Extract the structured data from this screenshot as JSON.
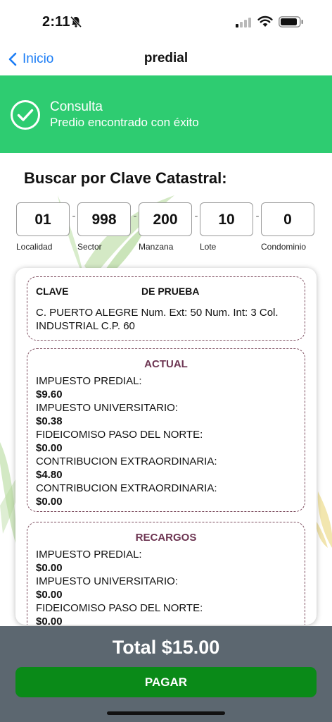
{
  "status_bar": {
    "time": "2:11"
  },
  "nav": {
    "back_label": "Inicio",
    "title": "predial"
  },
  "banner": {
    "title": "Consulta",
    "subtitle": "Predio encontrado con éxito"
  },
  "search": {
    "title": "Buscar por Clave Catastral:",
    "fields": [
      {
        "label": "Localidad",
        "value": "01"
      },
      {
        "label": "Sector",
        "value": "998"
      },
      {
        "label": "Manzana",
        "value": "200"
      },
      {
        "label": "Lote",
        "value": "10"
      },
      {
        "label": "Condominio",
        "value": "0"
      }
    ],
    "separator": "-"
  },
  "property": {
    "clave_label": "CLAVE",
    "clave_value": "DE PRUEBA",
    "address": "C. PUERTO ALEGRE Num. Ext: 50 Num. Int: 3 Col. INDUSTRIAL C.P. 60"
  },
  "actual": {
    "title": "ACTUAL",
    "items": [
      {
        "name": "IMPUESTO PREDIAL:",
        "amount": "$9.60"
      },
      {
        "name": "IMPUESTO UNIVERSITARIO:",
        "amount": "$0.38"
      },
      {
        "name": "FIDEICOMISO PASO DEL NORTE:",
        "amount": "$0.00"
      },
      {
        "name": "CONTRIBUCION EXTRAORDINARIA:",
        "amount": "$4.80"
      },
      {
        "name": "CONTRIBUCION EXTRAORDINARIA:",
        "amount": "$0.00"
      }
    ]
  },
  "recargos": {
    "title": "RECARGOS",
    "items": [
      {
        "name": "IMPUESTO PREDIAL:",
        "amount": "$0.00"
      },
      {
        "name": "IMPUESTO UNIVERSITARIO:",
        "amount": "$0.00"
      },
      {
        "name": "FIDEICOMISO PASO DEL NORTE:",
        "amount": "$0.00"
      }
    ]
  },
  "footer": {
    "total": "Total $15.00",
    "pay_label": "PAGAR"
  },
  "colors": {
    "banner": "#2ecc71",
    "accent_blue": "#1a7cf5",
    "section_title": "#6d3552",
    "pay_button": "#0a8a18",
    "footer_bg": "#5c6770"
  }
}
